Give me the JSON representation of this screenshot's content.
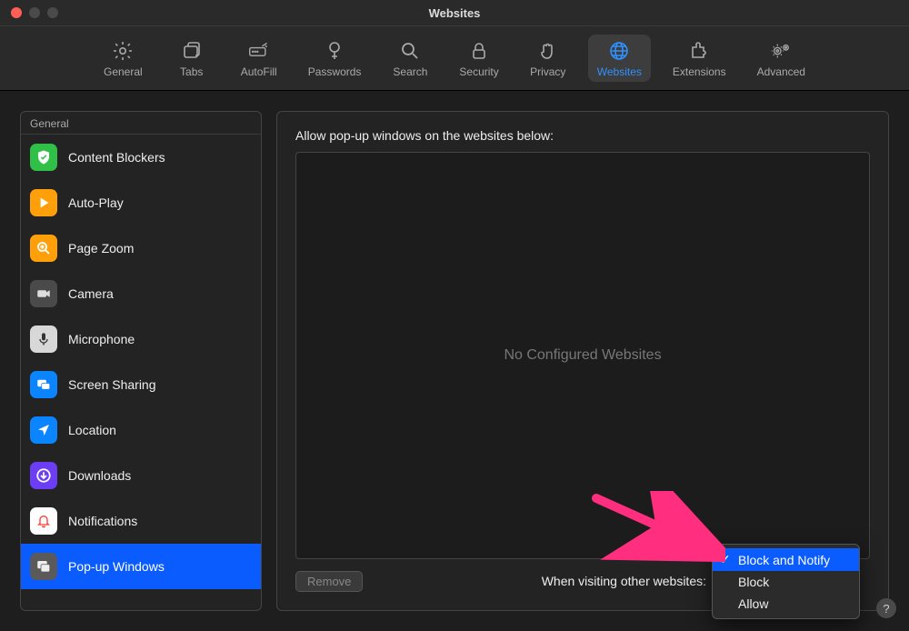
{
  "window": {
    "title": "Websites"
  },
  "toolbar": {
    "items": [
      {
        "label": "General"
      },
      {
        "label": "Tabs"
      },
      {
        "label": "AutoFill"
      },
      {
        "label": "Passwords"
      },
      {
        "label": "Search"
      },
      {
        "label": "Security"
      },
      {
        "label": "Privacy"
      },
      {
        "label": "Websites"
      },
      {
        "label": "Extensions"
      },
      {
        "label": "Advanced"
      }
    ]
  },
  "sidebar": {
    "group_label": "General",
    "items": [
      {
        "label": "Content Blockers"
      },
      {
        "label": "Auto-Play"
      },
      {
        "label": "Page Zoom"
      },
      {
        "label": "Camera"
      },
      {
        "label": "Microphone"
      },
      {
        "label": "Screen Sharing"
      },
      {
        "label": "Location"
      },
      {
        "label": "Downloads"
      },
      {
        "label": "Notifications"
      },
      {
        "label": "Pop-up Windows"
      }
    ]
  },
  "main": {
    "heading": "Allow pop-up windows on the websites below:",
    "empty_text": "No Configured Websites",
    "remove_label": "Remove",
    "when_label": "When visiting other websites:"
  },
  "dropdown": {
    "options": [
      {
        "label": "Block and Notify",
        "selected": true
      },
      {
        "label": "Block",
        "selected": false
      },
      {
        "label": "Allow",
        "selected": false
      }
    ]
  },
  "help": {
    "label": "?"
  },
  "colors": {
    "accent": "#0a5cff",
    "toolbar_active": "#2f91ff",
    "arrow": "#ff2e7e"
  }
}
